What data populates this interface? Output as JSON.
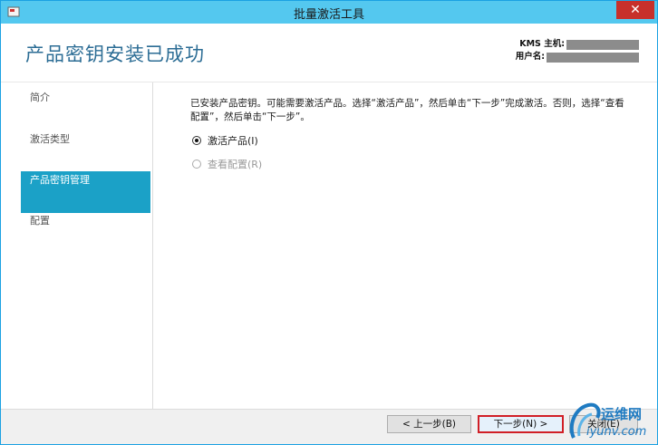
{
  "window": {
    "title": "批量激活工具",
    "close_glyph": "✕"
  },
  "header": {
    "title": "产品密钥安装已成功",
    "kms_host_label": "KMS 主机:",
    "user_label": "用户名:"
  },
  "nav": {
    "items": [
      {
        "label": "简介"
      },
      {
        "label": "激活类型"
      },
      {
        "label": "产品密钥管理"
      },
      {
        "label": "配置"
      }
    ]
  },
  "content": {
    "description": "已安装产品密钥。可能需要激活产品。选择“激活产品”，然后单击“下一步”完成激活。否则，选择“查看配置”，然后单击“下一步”。",
    "options": [
      {
        "label": "激活产品(I)",
        "checked": true,
        "enabled": true
      },
      {
        "label": "查看配置(R)",
        "checked": false,
        "enabled": false
      }
    ]
  },
  "footer": {
    "back_label": "< 上一步(B)",
    "next_label": "下一步(N) >",
    "close_label": "关闭(E)"
  },
  "watermark": {
    "cn": "运维网",
    "en": "iyunv.com"
  },
  "colors": {
    "titlebar": "#54c8ef",
    "accent": "#1ba1c7",
    "title_text": "#2c6d95",
    "close": "#c7302b"
  }
}
